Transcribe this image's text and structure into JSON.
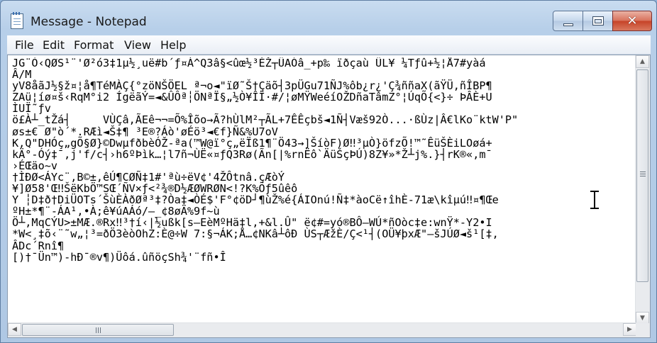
{
  "window": {
    "title": "Message - Notepad"
  },
  "controls": {
    "minimize_icon": "minimize-icon",
    "maximize_icon": "maximize-icon",
    "close_icon": "close-icon",
    "close_glyph": "✕"
  },
  "menu": [
    "File",
    "Edit",
    "Format",
    "View",
    "Help"
  ],
  "editor": {
    "lines": [
      "JG¨Ò‹QØS¹¨'Ø²ó3‡1µ½¸uë#b´ƒ¤Á^Q3â§<ûœ½³ÉŽ┬ÜAÓâ_+p‰ ïðçaù ÜL¥ ¼Tƒû+½¦Å7#yàá",
      "Â/M",
      "yV8åãJ½§ž¤¦å¶TéMÀÇ{°zöNŠÖEL ª¬o◄\"ïØ˜Š†Çäõ┤3pÜGu71ÑJ%ôb¿r¿'Ç¾ññaX(ãŸÜ,ñÎBP¶",
      "ZAü¦íø¤š‹RqM°i2 ÍgëãÝ=◄&ÛÔª┆ÖNªÏ§„½Ò¥ÎÏ·#/¦øMŸWeéíOŽDñaTâmZ°¦ÚqÕ{<}÷ ÞÂÈ+U",
      "ÌUÏ˜ƒv",
      "ö£À┴_tŽá┤     VÙÇâ,ÃEê¬¬=Õ%Îõo→Ã?hÙlM²┬ÃL+7ÊÊçbš◄1Ñ┤Væš92Ò...·ßÙz|Â€lKo¨ktW'P\"",
      "øs±€ Ø\"ò´*.RÆì◄Š‡¶ ³E®?Áò'øÉö³◄€f}Ñ&%U7oV",
      "K,Q\"DHÓç„gÕ§Ø}©DwµfðbèÓŽ-ªa(™W@ï°ç„ëÏß1¶¨Ö43→]ŠíòF)Ø‼³µÒ}öfzÕ!™˜ÊüŠÈiLOøá+",
      "kÄ°-Óý‡¯,j'f/c┤›h6ºÞìk…¦l7ñ¬ÙË«¤ƒQ3Rø(Ãn[|%rnËô`ÄüŠçÞÚ)8Z¥»*Ž┴j%.}┤rK®«,m¯",
      "›ÉŒäo~v",
      "†ÌÐØ<ÁYc¨,B©±,êÚ¶CØÑ‡1#'ªù÷ëV¢'4ŽÔtnâ.çÆòÝ",
      "¥]Ø58'Œ‼ŠëKbÖ™SŒ´ÑV×ƒ<²¾®D½ÆØWRØN<!?K%Õƒ5ûêô",
      "Y ┆D‡ð†DiÜOTs´ŠùÈÀðØª³‡?Òa‡◄ÒÉ$'F°¢öD┘¶ùŽ%é{ÁIOnú!Ñ‡*àoCë↑îhÈ-71æ\\kîµú‼¤¶Œe",
      "ºH±*¶¨-ÁA¹,•À;ê¥úAÁó/—_¢8øÄ%9f~ù",
      "Ö┴,MqCÝU>±MÆ.®Rx‼³†í‹|½ußk[s—EèMºHä‡l,+&l.Û\" ë¢#=yó®BÔ–WÚ*ñOòc‡e:wnŸ*-Y2•I",
      "*W<¸‡õ‹¨˜w„¦³=ðÖ3èòOhZ:È@÷W 7:§¬ÁK;Å…¢NKâ┴ôÐ ÙS┬ÆžÈ/Ç<¹┤(OÜ¥þxÆ\"–šJÚØ◄š¹[‡,",
      "ÂDc´Rnî¶",
      "[)†¯Ün™)-hÐ¯®v¶)Üôá.ûñöçSh¾'¨fñ•Î"
    ]
  }
}
